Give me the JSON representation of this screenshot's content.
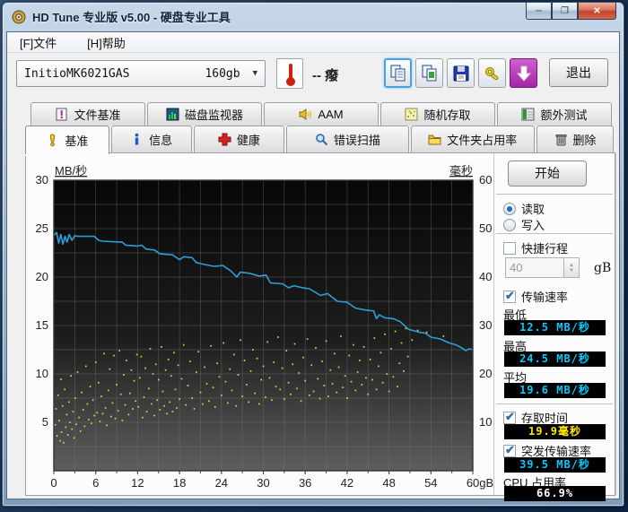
{
  "window": {
    "title": "HD Tune 专业版 v5.00 - 硬盘专业工具",
    "minimize": "─",
    "restore": "❐",
    "close": "✕"
  },
  "menu": {
    "file": "[F]文件",
    "help": "[H]帮助"
  },
  "toolbar": {
    "drive": {
      "name": "InitioMK6021GAS",
      "capacity": "160gb"
    },
    "temperature": {
      "value": "--",
      "unit": "癈"
    },
    "exit_label": "退出"
  },
  "tabs_top": [
    {
      "label": "文件基准"
    },
    {
      "label": "磁盘监视器"
    },
    {
      "label": "AAM"
    },
    {
      "label": "随机存取"
    },
    {
      "label": "额外测试"
    }
  ],
  "tabs_main": [
    {
      "label": "基准",
      "active": true
    },
    {
      "label": "信息"
    },
    {
      "label": "健康"
    },
    {
      "label": "错误扫描"
    },
    {
      "label": "文件夹占用率"
    },
    {
      "label": "删除"
    }
  ],
  "panel": {
    "start_label": "开始",
    "read": {
      "label": "读取",
      "checked": true
    },
    "write": {
      "label": "写入",
      "checked": false
    },
    "quick_span": {
      "label": "快捷行程",
      "checked": false,
      "value": "40",
      "unit": "gB"
    },
    "transfer_rate": {
      "label": "传输速率",
      "checked": true
    },
    "min": {
      "label": "最低",
      "value": "12.5",
      "unit": "MB/秒"
    },
    "max": {
      "label": "最高",
      "value": "24.5",
      "unit": "MB/秒"
    },
    "avg": {
      "label": "平均",
      "value": "19.6",
      "unit": "MB/秒"
    },
    "access_time": {
      "label": "存取时间",
      "checked": true,
      "value": "19.9",
      "unit": "毫秒"
    },
    "burst_rate": {
      "label": "突发传输速率",
      "checked": true,
      "value": "39.5",
      "unit": "MB/秒"
    },
    "cpu": {
      "label": "CPU 占用率",
      "value": "66.9%"
    }
  },
  "chart_data": {
    "type": "line",
    "title": "",
    "ylabel_left": "MB/秒",
    "ylabel_right": "毫秒",
    "xlabel": "",
    "xlim": [
      0,
      60
    ],
    "ylim_left": [
      0,
      30
    ],
    "ylim_right": [
      0,
      60
    ],
    "grid_step_x": 3,
    "grid_step_y_left": 2.5,
    "x_tick_labels": [
      "0",
      "6",
      "12",
      "18",
      "24",
      "30",
      "36",
      "42",
      "48",
      "54",
      "60gB"
    ],
    "x_tick_values": [
      0,
      6,
      12,
      18,
      24,
      30,
      36,
      42,
      48,
      54,
      60
    ],
    "y_ticks_left": [
      30,
      25,
      20,
      15,
      10,
      5
    ],
    "y_ticks_right": [
      60,
      50,
      40,
      30,
      20,
      10
    ],
    "series": [
      {
        "name": "传输速率",
        "type": "line",
        "axis": "left",
        "color": "#2d9fd8",
        "points": [
          [
            0,
            24.3
          ],
          [
            0.4,
            24.6
          ],
          [
            0.7,
            23.5
          ],
          [
            1.0,
            24.4
          ],
          [
            1.3,
            23.4
          ],
          [
            1.6,
            24.2
          ],
          [
            1.9,
            23.6
          ],
          [
            2.2,
            24.4
          ],
          [
            2.6,
            23.8
          ],
          [
            3.0,
            24.3
          ],
          [
            3.4,
            24.2
          ],
          [
            5.8,
            24.2
          ],
          [
            6.4,
            23.8
          ],
          [
            7.0,
            23.7
          ],
          [
            9.8,
            23.6
          ],
          [
            10.3,
            23.3
          ],
          [
            12.0,
            23.2
          ],
          [
            12.6,
            23.3
          ],
          [
            13.2,
            22.9
          ],
          [
            14.4,
            22.8
          ],
          [
            15.2,
            22.4
          ],
          [
            17.0,
            22.3
          ],
          [
            18.0,
            21.8
          ],
          [
            18.6,
            22.1
          ],
          [
            19.8,
            22.0
          ],
          [
            20.4,
            21.5
          ],
          [
            21.6,
            21.3
          ],
          [
            23.0,
            21.1
          ],
          [
            24.2,
            21.2
          ],
          [
            25.4,
            20.6
          ],
          [
            26.2,
            20.0
          ],
          [
            26.7,
            20.5
          ],
          [
            28.0,
            20.4
          ],
          [
            29.4,
            20.1
          ],
          [
            30.4,
            20.2
          ],
          [
            31.0,
            19.4
          ],
          [
            32.8,
            19.3
          ],
          [
            33.6,
            18.9
          ],
          [
            34.4,
            19.1
          ],
          [
            35.6,
            18.9
          ],
          [
            36.6,
            18.8
          ],
          [
            38.2,
            18.1
          ],
          [
            39.2,
            18.3
          ],
          [
            40.6,
            17.5
          ],
          [
            42.0,
            17.4
          ],
          [
            43.2,
            16.8
          ],
          [
            44.6,
            16.6
          ],
          [
            45.8,
            16.5
          ],
          [
            46.2,
            15.7
          ],
          [
            46.6,
            16.1
          ],
          [
            47.4,
            15.8
          ],
          [
            48.6,
            15.7
          ],
          [
            49.6,
            15.4
          ],
          [
            50.8,
            14.6
          ],
          [
            52.4,
            14.3
          ],
          [
            53.2,
            14.2
          ],
          [
            54.0,
            13.8
          ],
          [
            55.4,
            13.6
          ],
          [
            56.6,
            13.2
          ],
          [
            57.6,
            13.0
          ],
          [
            58.4,
            12.7
          ],
          [
            59.0,
            12.4
          ],
          [
            59.5,
            12.6
          ],
          [
            60,
            12.5
          ]
        ]
      },
      {
        "name": "存取时间",
        "type": "scatter",
        "axis": "right",
        "color": "#d6d642",
        "points": [
          [
            0.2,
            9.5
          ],
          [
            0.3,
            12.8
          ],
          [
            0.45,
            7.2
          ],
          [
            0.6,
            15.6
          ],
          [
            0.75,
            10.4
          ],
          [
            0.9,
            6.2
          ],
          [
            1.0,
            18.9
          ],
          [
            1.1,
            8.0
          ],
          [
            1.25,
            13.4
          ],
          [
            1.4,
            5.8
          ],
          [
            1.55,
            16.8
          ],
          [
            1.7,
            9.0
          ],
          [
            1.85,
            11.6
          ],
          [
            2.0,
            7.4
          ],
          [
            2.15,
            14.2
          ],
          [
            2.3,
            10.0
          ],
          [
            2.45,
            19.6
          ],
          [
            2.6,
            8.6
          ],
          [
            2.75,
            12.2
          ],
          [
            2.9,
            6.8
          ],
          [
            3.05,
            15.0
          ],
          [
            3.2,
            9.6
          ],
          [
            3.4,
            20.4
          ],
          [
            3.6,
            11.0
          ],
          [
            3.8,
            8.2
          ],
          [
            4.0,
            16.2
          ],
          [
            4.2,
            12.6
          ],
          [
            4.4,
            9.2
          ],
          [
            4.6,
            21.6
          ],
          [
            4.8,
            13.8
          ],
          [
            5.0,
            10.6
          ],
          [
            5.2,
            17.4
          ],
          [
            5.4,
            9.8
          ],
          [
            5.6,
            14.6
          ],
          [
            5.8,
            11.4
          ],
          [
            6.0,
            22.4
          ],
          [
            6.2,
            12.0
          ],
          [
            6.4,
            18.2
          ],
          [
            6.6,
            10.2
          ],
          [
            6.8,
            15.4
          ],
          [
            7.0,
            11.8
          ],
          [
            7.2,
            24.2
          ],
          [
            7.4,
            13.0
          ],
          [
            7.6,
            9.4
          ],
          [
            7.8,
            16.6
          ],
          [
            8.0,
            21.0
          ],
          [
            8.2,
            11.2
          ],
          [
            8.4,
            14.0
          ],
          [
            8.6,
            23.8
          ],
          [
            8.8,
            10.8
          ],
          [
            9.0,
            17.8
          ],
          [
            9.2,
            12.4
          ],
          [
            9.4,
            24.8
          ],
          [
            9.6,
            15.8
          ],
          [
            9.8,
            10.4
          ],
          [
            10.0,
            19.8
          ],
          [
            10.2,
            13.6
          ],
          [
            10.4,
            22.8
          ],
          [
            10.7,
            11.6
          ],
          [
            10.9,
            16.0
          ],
          [
            11.1,
            20.8
          ],
          [
            11.3,
            12.8
          ],
          [
            11.5,
            18.6
          ],
          [
            11.7,
            14.4
          ],
          [
            11.9,
            24.0
          ],
          [
            12.1,
            13.2
          ],
          [
            12.3,
            19.2
          ],
          [
            12.5,
            23.6
          ],
          [
            12.7,
            11.0
          ],
          [
            12.9,
            15.2
          ],
          [
            13.1,
            21.2
          ],
          [
            13.3,
            12.2
          ],
          [
            13.6,
            17.0
          ],
          [
            13.8,
            25.2
          ],
          [
            14.0,
            13.8
          ],
          [
            14.2,
            20.0
          ],
          [
            14.4,
            11.4
          ],
          [
            14.6,
            22.0
          ],
          [
            14.8,
            14.6
          ],
          [
            15.0,
            18.8
          ],
          [
            15.2,
            12.6
          ],
          [
            15.4,
            25.6
          ],
          [
            15.6,
            16.4
          ],
          [
            15.8,
            13.4
          ],
          [
            16.0,
            20.8
          ],
          [
            16.2,
            11.8
          ],
          [
            16.4,
            23.0
          ],
          [
            16.6,
            14.2
          ],
          [
            16.8,
            19.6
          ],
          [
            17.0,
            12.2
          ],
          [
            17.2,
            24.4
          ],
          [
            17.4,
            16.8
          ],
          [
            17.6,
            13.0
          ],
          [
            17.8,
            21.8
          ],
          [
            18.0,
            14.8
          ],
          [
            18.3,
            19.0
          ],
          [
            18.6,
            26.0
          ],
          [
            18.9,
            13.6
          ],
          [
            19.2,
            17.6
          ],
          [
            19.5,
            22.6
          ],
          [
            19.8,
            15.0
          ],
          [
            20.1,
            12.8
          ],
          [
            20.4,
            20.4
          ],
          [
            20.7,
            24.6
          ],
          [
            21.0,
            16.2
          ],
          [
            21.3,
            13.8
          ],
          [
            21.6,
            21.4
          ],
          [
            21.9,
            18.0
          ],
          [
            22.2,
            14.4
          ],
          [
            22.5,
            25.8
          ],
          [
            22.8,
            17.2
          ],
          [
            23.1,
            13.2
          ],
          [
            23.4,
            22.2
          ],
          [
            23.7,
            19.4
          ],
          [
            24.0,
            15.6
          ],
          [
            24.3,
            26.4
          ],
          [
            24.6,
            18.4
          ],
          [
            24.9,
            14.0
          ],
          [
            25.2,
            21.0
          ],
          [
            25.5,
            16.6
          ],
          [
            25.8,
            24.0
          ],
          [
            26.1,
            13.4
          ],
          [
            26.4,
            19.8
          ],
          [
            26.7,
            27.0
          ],
          [
            27.0,
            15.4
          ],
          [
            27.3,
            22.8
          ],
          [
            27.6,
            17.8
          ],
          [
            27.9,
            14.2
          ],
          [
            28.2,
            20.6
          ],
          [
            28.5,
            25.0
          ],
          [
            28.8,
            16.0
          ],
          [
            29.1,
            23.2
          ],
          [
            29.4,
            13.8
          ],
          [
            29.7,
            18.8
          ],
          [
            30.0,
            21.6
          ],
          [
            30.3,
            15.2
          ],
          [
            30.6,
            26.6
          ],
          [
            30.9,
            19.2
          ],
          [
            31.2,
            14.6
          ],
          [
            31.5,
            22.4
          ],
          [
            31.8,
            17.4
          ],
          [
            32.1,
            27.6
          ],
          [
            32.4,
            16.8
          ],
          [
            32.7,
            21.2
          ],
          [
            33.0,
            14.8
          ],
          [
            33.3,
            24.8
          ],
          [
            33.6,
            18.2
          ],
          [
            33.9,
            15.8
          ],
          [
            34.2,
            22.0
          ],
          [
            34.5,
            26.2
          ],
          [
            34.8,
            17.0
          ],
          [
            35.1,
            20.2
          ],
          [
            35.4,
            14.4
          ],
          [
            35.7,
            23.4
          ],
          [
            36.0,
            18.6
          ],
          [
            36.3,
            27.2
          ],
          [
            36.6,
            15.6
          ],
          [
            36.9,
            21.8
          ],
          [
            37.2,
            16.4
          ],
          [
            37.5,
            25.4
          ],
          [
            37.8,
            19.0
          ],
          [
            38.1,
            14.9
          ],
          [
            38.4,
            22.6
          ],
          [
            38.7,
            17.6
          ],
          [
            39.0,
            26.8
          ],
          [
            39.3,
            15.4
          ],
          [
            39.6,
            20.8
          ],
          [
            39.9,
            18.0
          ],
          [
            40.2,
            24.2
          ],
          [
            40.5,
            16.2
          ],
          [
            40.8,
            21.4
          ],
          [
            41.1,
            27.8
          ],
          [
            41.4,
            17.2
          ],
          [
            41.7,
            19.6
          ],
          [
            42.0,
            15.0
          ],
          [
            42.3,
            23.8
          ],
          [
            42.6,
            18.4
          ],
          [
            42.9,
            26.0
          ],
          [
            43.2,
            16.6
          ],
          [
            43.5,
            20.4
          ],
          [
            43.8,
            22.8
          ],
          [
            44.1,
            17.8
          ],
          [
            44.4,
            25.6
          ],
          [
            44.7,
            19.2
          ],
          [
            45.0,
            15.8
          ],
          [
            45.3,
            23.0
          ],
          [
            45.6,
            18.8
          ],
          [
            45.9,
            27.4
          ],
          [
            46.2,
            16.8
          ],
          [
            46.5,
            21.6
          ],
          [
            46.8,
            24.4
          ],
          [
            47.1,
            18.2
          ],
          [
            47.4,
            28.2
          ],
          [
            47.7,
            20.0
          ],
          [
            48.0,
            16.4
          ],
          [
            48.3,
            25.2
          ],
          [
            48.6,
            19.4
          ],
          [
            48.9,
            28.8
          ],
          [
            49.2,
            17.4
          ],
          [
            49.5,
            22.2
          ],
          [
            49.8,
            26.4
          ],
          [
            50.1,
            20.6
          ],
          [
            50.4,
            29.4
          ],
          [
            50.7,
            23.6
          ],
          [
            51.3,
            27.0
          ],
          [
            52.1,
            29.0
          ],
          [
            53.4,
            28.6
          ],
          [
            55.8,
            27.8
          ]
        ]
      }
    ]
  }
}
